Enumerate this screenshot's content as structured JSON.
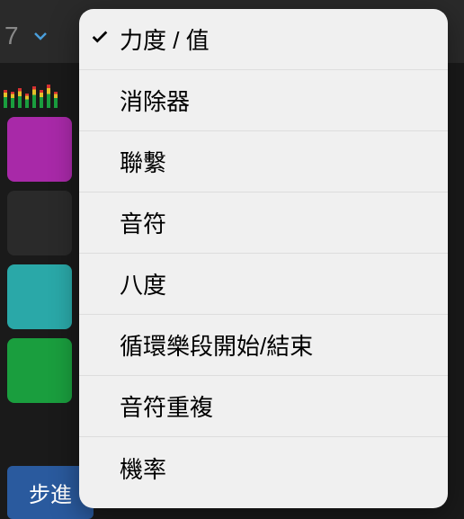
{
  "header": {
    "number": "7"
  },
  "bottomBar": {
    "stepButton": "步進"
  },
  "menu": {
    "items": [
      {
        "label": "力度 / 值",
        "selected": true
      },
      {
        "label": "消除器",
        "selected": false
      },
      {
        "label": "聯繫",
        "selected": false
      },
      {
        "label": "音符",
        "selected": false
      },
      {
        "label": "八度",
        "selected": false
      },
      {
        "label": "循環樂段開始/結束",
        "selected": false
      },
      {
        "label": "音符重複",
        "selected": false
      },
      {
        "label": "機率",
        "selected": false
      }
    ]
  }
}
